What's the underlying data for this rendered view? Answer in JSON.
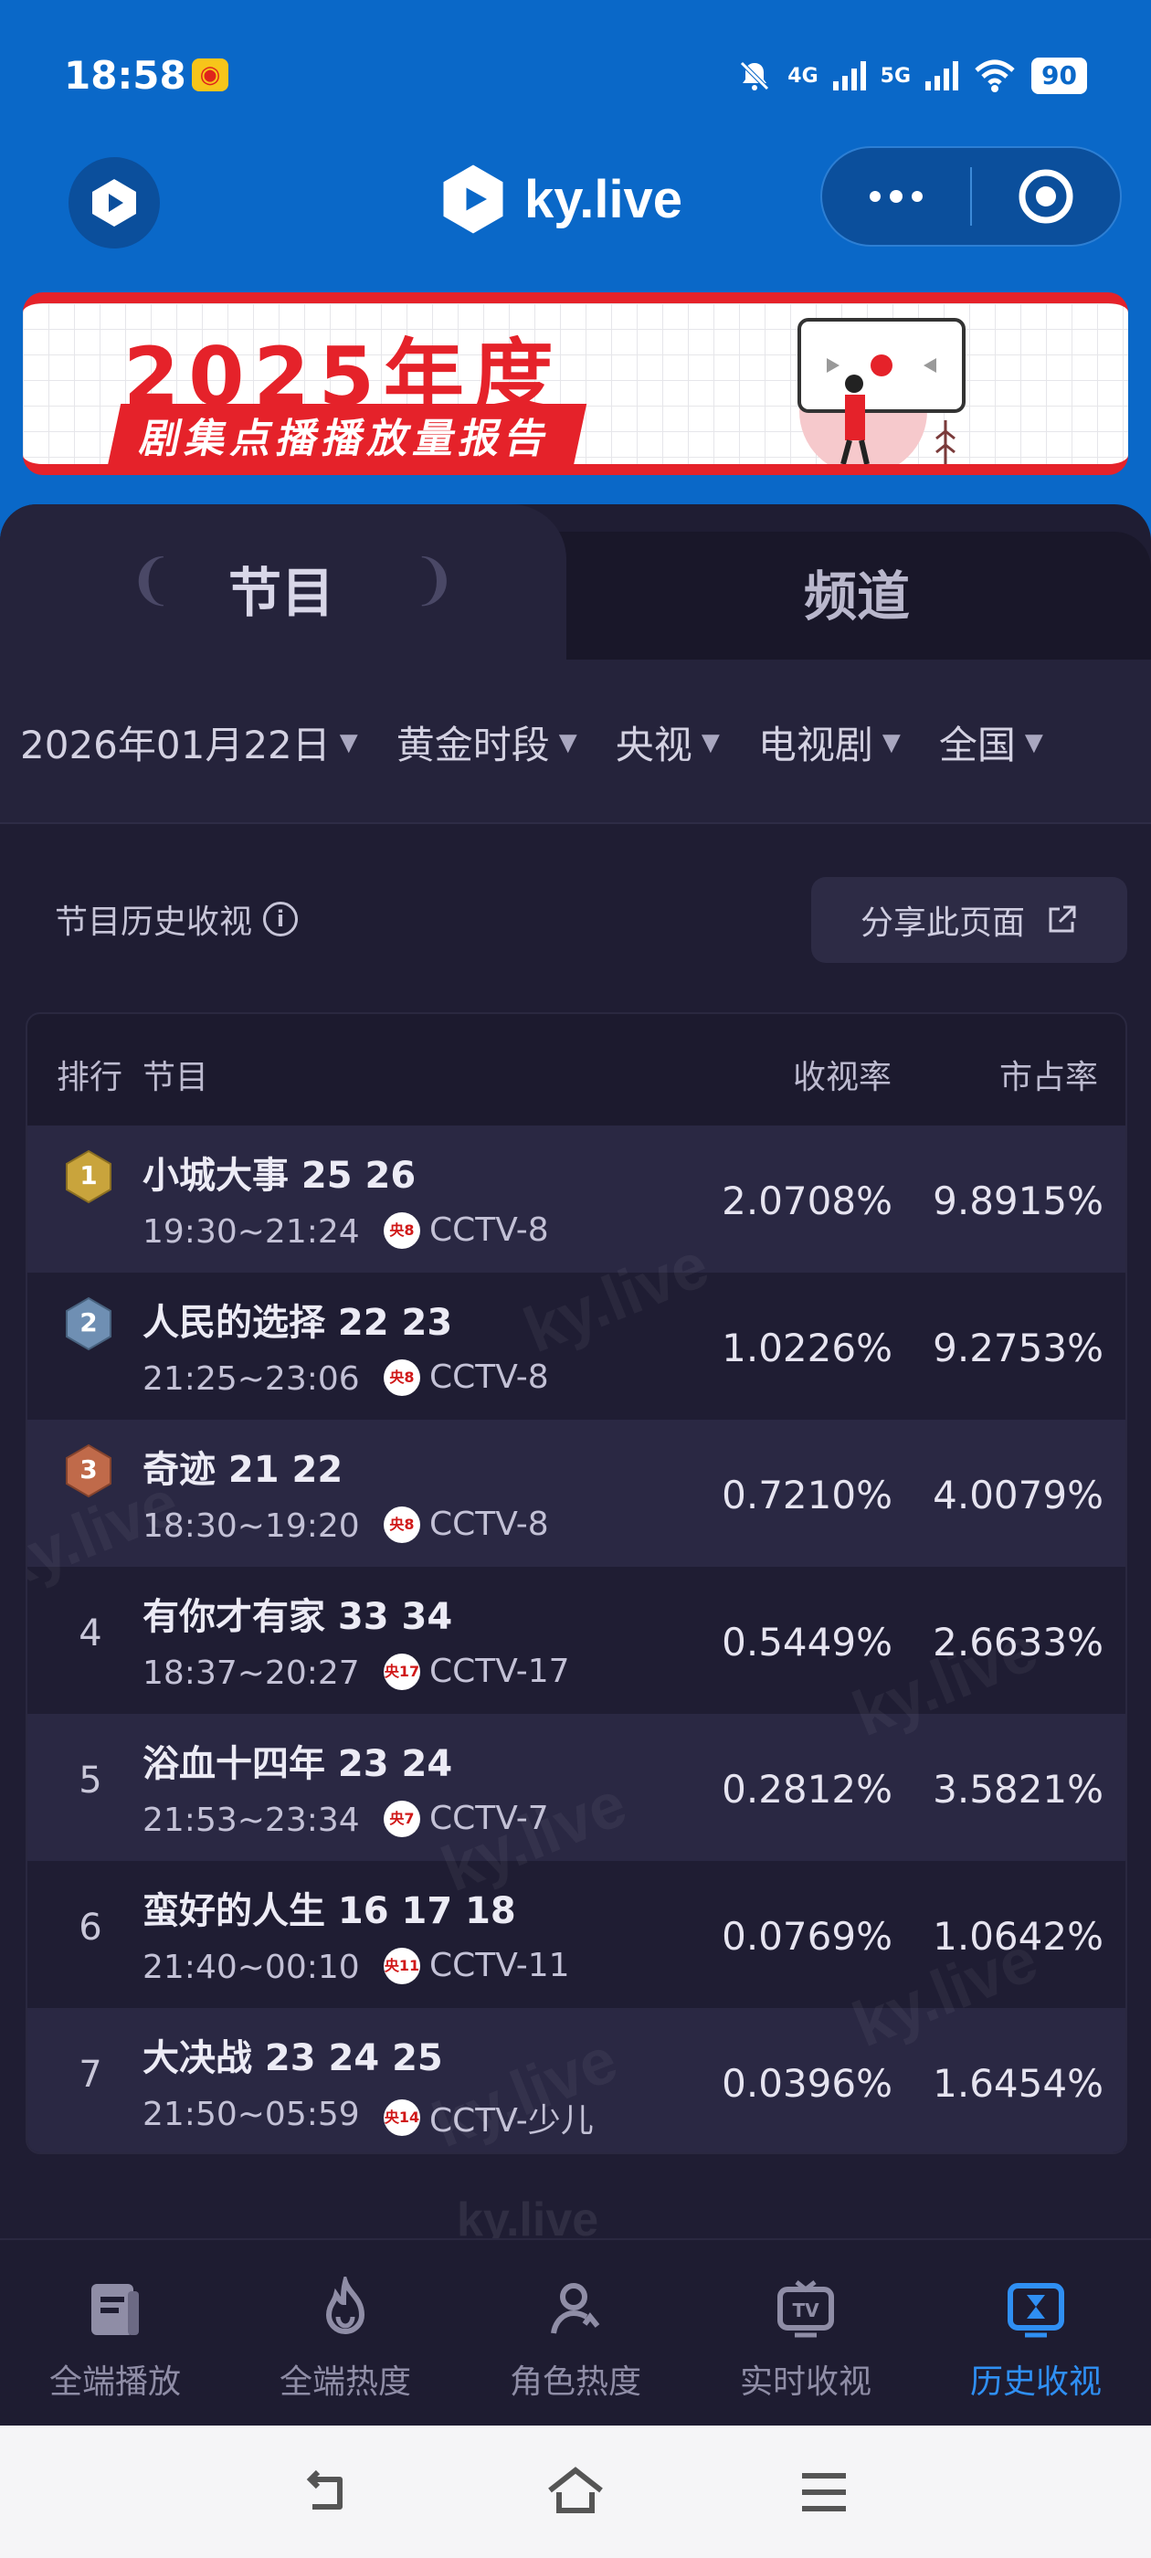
{
  "status_bar": {
    "time": "18:58",
    "network_1": "4G",
    "network_2": "5G",
    "battery": "90"
  },
  "header": {
    "brand": "ky.live"
  },
  "banner": {
    "title": "2025年度",
    "subtitle": "剧集点播播放量报告"
  },
  "tabs": [
    {
      "label": "节目",
      "active": true
    },
    {
      "label": "频道",
      "active": false
    }
  ],
  "filters": [
    {
      "label": "2026年01月22日"
    },
    {
      "label": "黄金时段"
    },
    {
      "label": "央视"
    },
    {
      "label": "电视剧"
    },
    {
      "label": "全国"
    }
  ],
  "section": {
    "title": "节目历史收视",
    "share_button": "分享此页面"
  },
  "table": {
    "headers": {
      "rank": "排行",
      "program": "节目",
      "rating": "收视率",
      "share": "市占率"
    },
    "rows": [
      {
        "rank": "1",
        "title": "小城大事 25 26",
        "time": "19:30~21:24",
        "channel_badge": "央8",
        "channel": "CCTV-8",
        "rating": "2.0708%",
        "share": "9.8915%"
      },
      {
        "rank": "2",
        "title": "人民的选择 22 23",
        "time": "21:25~23:06",
        "channel_badge": "央8",
        "channel": "CCTV-8",
        "rating": "1.0226%",
        "share": "9.2753%"
      },
      {
        "rank": "3",
        "title": "奇迹 21 22",
        "time": "18:30~19:20",
        "channel_badge": "央8",
        "channel": "CCTV-8",
        "rating": "0.7210%",
        "share": "4.0079%"
      },
      {
        "rank": "4",
        "title": "有你才有家 33 34",
        "time": "18:37~20:27",
        "channel_badge": "央17",
        "channel": "CCTV-17",
        "rating": "0.5449%",
        "share": "2.6633%"
      },
      {
        "rank": "5",
        "title": "浴血十四年 23 24",
        "time": "21:53~23:34",
        "channel_badge": "央7",
        "channel": "CCTV-7",
        "rating": "0.2812%",
        "share": "3.5821%"
      },
      {
        "rank": "6",
        "title": "蛮好的人生 16 17 18",
        "time": "21:40~00:10",
        "channel_badge": "央11",
        "channel": "CCTV-11",
        "rating": "0.0769%",
        "share": "1.0642%"
      },
      {
        "rank": "7",
        "title": "大决战 23 24 25",
        "time": "21:50~05:59",
        "channel_badge": "央14",
        "channel": "CCTV-少儿",
        "rating": "0.0396%",
        "share": "1.6454%"
      }
    ]
  },
  "tabbar": [
    {
      "label": "全端播放",
      "icon": "play-card-icon",
      "active": false
    },
    {
      "label": "全端热度",
      "icon": "flame-icon",
      "active": false
    },
    {
      "label": "角色热度",
      "icon": "user-icon",
      "active": false
    },
    {
      "label": "实时收视",
      "icon": "tv-icon",
      "active": false
    },
    {
      "label": "历史收视",
      "icon": "hourglass-icon",
      "active": true
    }
  ],
  "colors": {
    "brand_blue": "#0a68c8",
    "panel_bg": "#1f1d33",
    "active_tab": "#2f8ff3",
    "gold": "#c9a43c",
    "silver": "#6f8fb3",
    "bronze": "#c06a4a"
  }
}
